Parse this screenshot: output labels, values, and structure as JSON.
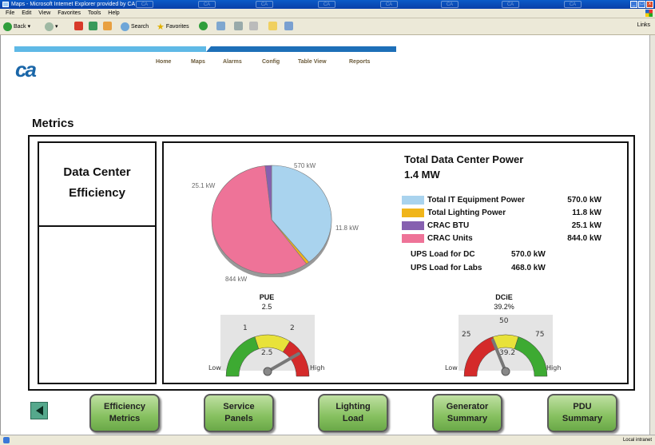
{
  "window": {
    "title": "Maps - Microsoft Internet Explorer provided by CA"
  },
  "menu": [
    "File",
    "Edit",
    "View",
    "Favorites",
    "Tools",
    "Help"
  ],
  "toolbar": {
    "back": "Back",
    "search": "Search",
    "favorites": "Favorites",
    "links": "Links"
  },
  "brand": {
    "logo": "ca"
  },
  "nav": [
    "Home",
    "Maps",
    "Alarms",
    "Config",
    "Table View",
    "Reports"
  ],
  "page": {
    "section_title": "Metrics",
    "left_panel_title": "Data Center Efficiency"
  },
  "power": {
    "title": "Total Data Center Power",
    "total": "1.4 MW",
    "legend": [
      {
        "name": "Total IT Equipment Power",
        "value": "570.0 kW",
        "color": "#a9d3ee"
      },
      {
        "name": "Total Lighting Power",
        "value": "11.8 kW",
        "color": "#f0b51a"
      },
      {
        "name": "CRAC BTU",
        "value": "25.1 kW",
        "color": "#8660b0"
      },
      {
        "name": "CRAC Units",
        "value": "844.0 kW",
        "color": "#ee7398"
      }
    ],
    "ups": [
      {
        "name": "UPS Load for DC",
        "value": "570.0 kW"
      },
      {
        "name": "UPS Load for Labs",
        "value": "468.0 kW"
      }
    ]
  },
  "chart_data": {
    "type": "pie",
    "categories": [
      "Total IT Equipment Power",
      "Total Lighting Power",
      "CRAC BTU",
      "CRAC Units"
    ],
    "values": [
      570.0,
      11.8,
      25.1,
      844.0
    ],
    "slice_labels": [
      "570 kW",
      "11.8 kW",
      "25.1 kW",
      "844 kW"
    ],
    "colors": [
      "#a9d3ee",
      "#f0b51a",
      "#8660b0",
      "#ee7398"
    ]
  },
  "pue_gauge": {
    "title": "PUE",
    "value": 2.5,
    "value_text": "2.5",
    "min_label": "Low",
    "max_label": "High",
    "ticks": [
      "1",
      "2"
    ],
    "dial_value_text": "2.5"
  },
  "dcie_gauge": {
    "title": "DCiE",
    "value": 39.2,
    "value_text": "39.2%",
    "min_label": "Low",
    "max_label": "High",
    "ticks": [
      "25",
      "50",
      "75"
    ],
    "dial_value_text": "39.2"
  },
  "footer": {
    "buttons": [
      "Efficiency\nMetrics",
      "Service\nPanels",
      "Lighting\nLoad",
      "Generator\nSummary",
      "PDU\nSummary"
    ]
  },
  "status": {
    "zone": "Local intranet"
  }
}
